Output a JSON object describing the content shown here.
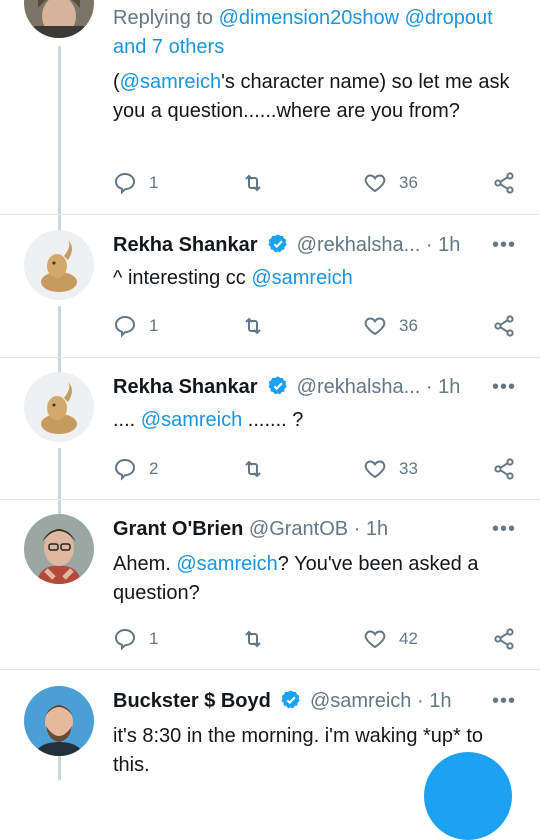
{
  "colors": {
    "accent": "#1da1f2",
    "link": "#1b95e0",
    "muted": "#657786",
    "thread": "#ccd6dd"
  },
  "tweet0": {
    "replying_prefix": "Replying to ",
    "replying_user1": "@dimension20show",
    "replying_user2": "@dropout",
    "replying_others": "and 7 others",
    "text_open": "(",
    "mention": "@samreich",
    "text_rest": "'s character name) so let me ask you a question......where are you from?",
    "replies": "1",
    "likes": "36"
  },
  "tweet1": {
    "name": "Rekha Shankar",
    "handle": "@rekhalsha...",
    "sep": "·",
    "time": "1h",
    "text_pre": "^ interesting cc ",
    "mention": "@samreich",
    "replies": "1",
    "likes": "36"
  },
  "tweet2": {
    "name": "Rekha Shankar",
    "handle": "@rekhalsha...",
    "sep": "·",
    "time": "1h",
    "text_pre": ".... ",
    "mention": "@samreich",
    "text_post": " ....... ?",
    "replies": "2",
    "likes": "33"
  },
  "tweet3": {
    "name": "Grant O'Brien",
    "handle": "@GrantOB",
    "sep": "·",
    "time": "1h",
    "text_pre": "Ahem. ",
    "mention": "@samreich",
    "text_post": "? You've been asked a question?",
    "replies": "1",
    "likes": "42"
  },
  "tweet4": {
    "name": "Buckster $ Boyd",
    "handle": "@samreich",
    "sep": "·",
    "time": "1h",
    "text": "it's 8:30 in the morning. i'm waking *up* to this."
  },
  "more_label": "•••",
  "icons": [
    "reply-icon",
    "retweet-icon",
    "like-icon",
    "share-icon",
    "verified-badge-icon",
    "more-options-icon",
    "compose-fab"
  ]
}
